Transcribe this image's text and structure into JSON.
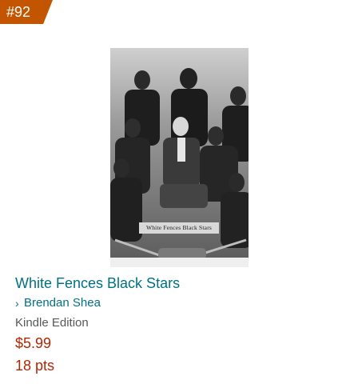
{
  "rank": "#92",
  "product": {
    "title": "White Fences Black Stars",
    "author": "Brendan Shea",
    "format": "Kindle Edition",
    "price": "$5.99",
    "points": "18 pts",
    "cover_text": "White Fences Black Stars"
  },
  "colors": {
    "badge": "#c45500",
    "link": "#007185",
    "price": "#b12704",
    "secondary_text": "#565959"
  },
  "icons": {
    "author_chevron": "chevron-right-icon"
  }
}
